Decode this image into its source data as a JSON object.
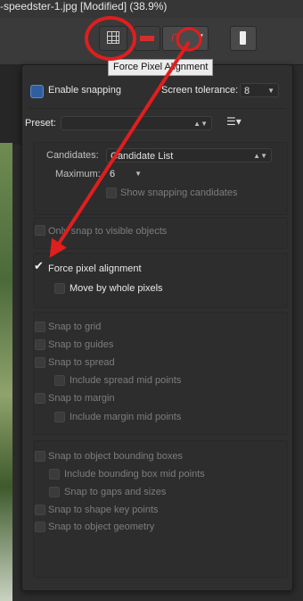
{
  "window": {
    "title": "-speedster-1.jpg [Modified] (38.9%)"
  },
  "toolbar": {
    "grid_icon": "pixel-grid-icon",
    "snap_icon": "snap-line-icon",
    "magnet_icon": "magnet-icon",
    "other_icon": "stroke-icon"
  },
  "tooltip": {
    "text": "Force Pixel Alignment"
  },
  "snapping": {
    "enable_label": "Enable snapping",
    "enabled": true,
    "screen_tolerance_label": "Screen tolerance:",
    "screen_tolerance_value": "8",
    "preset_label": "Preset:",
    "preset_value": "",
    "candidates_label": "Candidates:",
    "candidates_value": "Candidate List",
    "maximum_label": "Maximum:",
    "maximum_value": "6",
    "show_candidates_label": "Show snapping candidates",
    "only_visible_label": "Only snap to visible objects",
    "force_pixel_label": "Force pixel alignment",
    "force_pixel_checked": true,
    "move_whole_label": "Move by whole pixels",
    "grid_options": [
      "Snap to grid",
      "Snap to guides",
      "Snap to spread",
      "Include spread mid points",
      "Snap to margin",
      "Include margin mid points"
    ],
    "object_options": [
      "Snap to object bounding boxes",
      "Include bounding box mid points",
      "Snap to gaps and sizes",
      "Snap to shape key points",
      "Snap to object geometry"
    ]
  },
  "annotation": {
    "color": "#e01e1e"
  }
}
